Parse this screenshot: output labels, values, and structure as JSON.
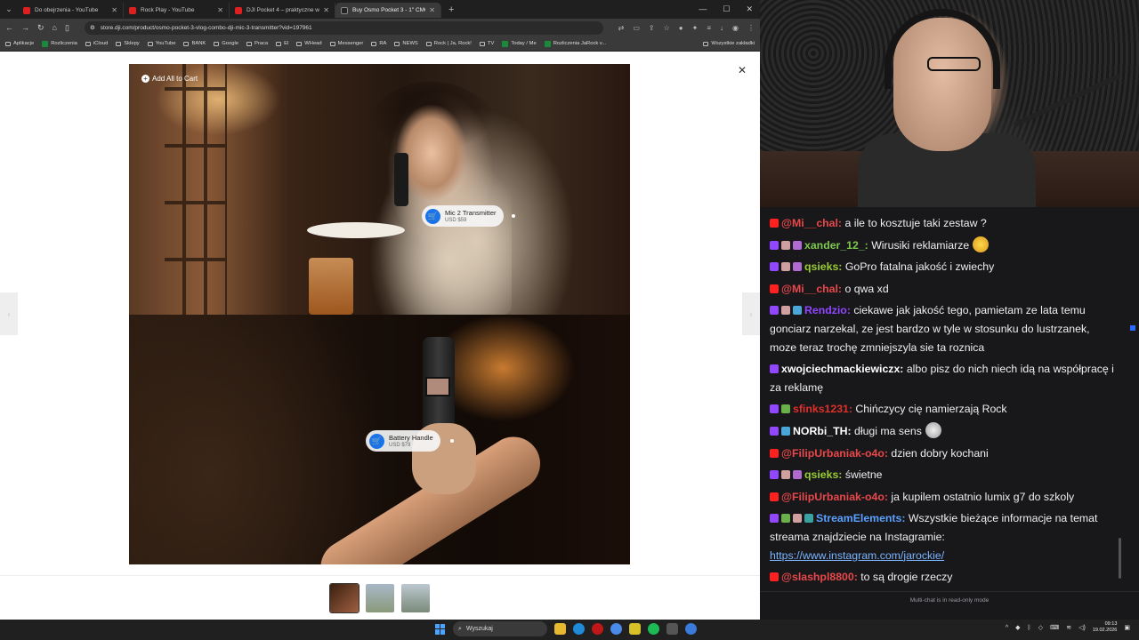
{
  "browser": {
    "tabs": [
      {
        "label": "Do obejrzenia - YouTube",
        "icon": "youtube-icon",
        "active": false
      },
      {
        "label": "Rock Play - YouTube",
        "icon": "youtube-icon",
        "active": false
      },
      {
        "label": "DJI Pocket 4 – praktyczne wrażen",
        "icon": "youtube-icon",
        "active": false
      },
      {
        "label": "Buy Osmo Pocket 3 - 1\" CMOS",
        "icon": "dji-icon",
        "active": true
      }
    ],
    "url": "store.dji.com/product/osmo-pocket-3-vlog-combo-dji-mic-3-transmitter?vid=197961",
    "bookmarks": [
      "Aplikacje",
      "Rozliczenia",
      "iCloud",
      "Sklepy",
      "YouTube",
      "BANK",
      "Google",
      "Praca",
      "El",
      "WHead",
      "Messenger",
      "RA",
      "NEWS",
      "Rock | Ja, Rock!",
      "TV",
      "Today / Me",
      "Rozliczenia JaRock v..."
    ],
    "bookmarks_end": "Wszystkie zakładki"
  },
  "page": {
    "add_all_label": "Add All to Cart",
    "hotspots": [
      {
        "name": "Mic 2 Transmitter",
        "price": "USD $59"
      },
      {
        "name": "Battery Handle",
        "price": "USD $79"
      }
    ]
  },
  "taskbar": {
    "search_placeholder": "Wyszukaj",
    "time": "09:13",
    "date": "19.02.2026"
  },
  "chat": {
    "messages": [
      {
        "platform": "youtube",
        "user": "@Mi__chal:",
        "color": "#e8484a",
        "text": "a ile to kosztuje taki zestaw ?"
      },
      {
        "platform": "twitch",
        "user": "xander_12_:",
        "color": "#7ec850",
        "text": "Wirusiki reklamiarze"
      },
      {
        "platform": "twitch",
        "user": "qsieks:",
        "color": "#9acd32",
        "text": "GoPro fatalna jakość i zwiechy"
      },
      {
        "platform": "youtube",
        "user": "@Mi__chal:",
        "color": "#e8484a",
        "text": "o qwa xd"
      },
      {
        "platform": "twitch",
        "user": "Rendzio:",
        "color": "#9146ff",
        "text": "ciekawe jak jakość tego, pamietam ze lata temu gonciarz narzekal, ze jest bardzo w tyle w stosunku do lustrzanek, moze teraz trochę zmniejszyla sie ta roznica"
      },
      {
        "platform": "twitch",
        "user": "xwojciechmackiewiczx:",
        "color": "#ffffff",
        "text": "albo pisz do nich niech idą na współpracę i za reklamę"
      },
      {
        "platform": "twitch",
        "user": "sfinks1231:",
        "color": "#e0302a",
        "text": "Chińczycy cię namierzają Rock"
      },
      {
        "platform": "twitch",
        "user": "NORbi_TH:",
        "color": "#ffffff",
        "text": "długi ma sens"
      },
      {
        "platform": "youtube",
        "user": "@FilipUrbaniak-o4o:",
        "color": "#e8484a",
        "text": "dzien dobry kochani"
      },
      {
        "platform": "twitch",
        "user": "qsieks:",
        "color": "#9acd32",
        "text": "świetne"
      },
      {
        "platform": "youtube",
        "user": "@FilipUrbaniak-o4o:",
        "color": "#e8484a",
        "text": "ja kupilem ostatnio lumix g7 do szkoly"
      },
      {
        "platform": "twitch",
        "user": "StreamElements:",
        "color": "#5aa0ff",
        "text": "Wszystkie bieżące informacje na temat streama znajdziecie na Instagramie:",
        "link": "https://www.instagram.com/jarockie/"
      },
      {
        "platform": "youtube",
        "user": "@slashpl8800:",
        "color": "#e8484a",
        "text": "to są drogie rzeczy"
      }
    ],
    "footer": "Multi-chat is in read-only mode"
  }
}
